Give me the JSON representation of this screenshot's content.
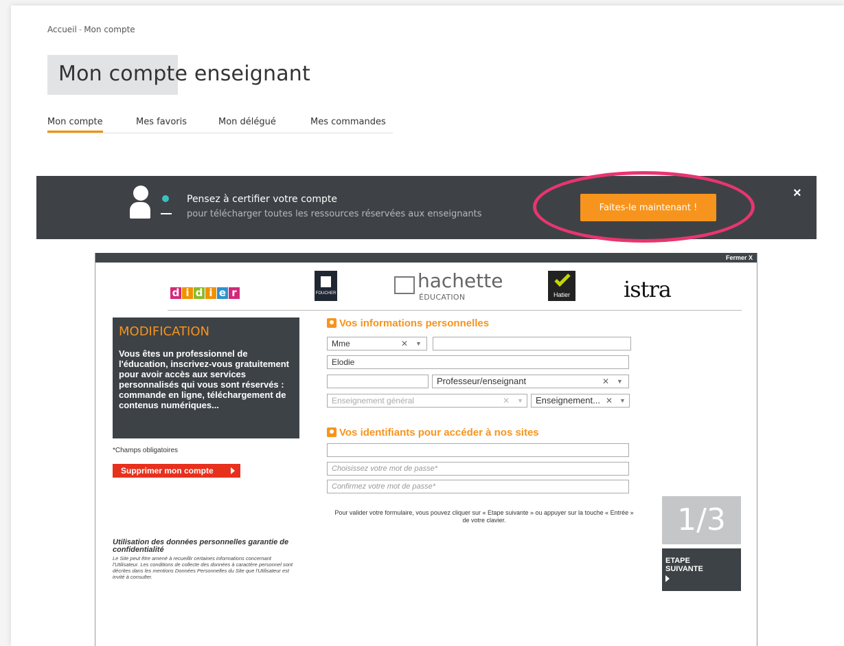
{
  "breadcrumb": {
    "home": "Accueil",
    "separator": "-",
    "current": "Mon compte"
  },
  "page_title": "Mon compte enseignant",
  "tabs": [
    {
      "label": "Mon compte",
      "active": true
    },
    {
      "label": "Mes favoris",
      "active": false
    },
    {
      "label": "Mon délégué",
      "active": false
    },
    {
      "label": "Mes commandes",
      "active": false
    }
  ],
  "banner": {
    "title": "Pensez à certifier votre compte",
    "subtitle": "pour télécharger toutes les ressources réservées aux enseignants",
    "cta_label": "Faites-le maintenant !",
    "close_label": "×",
    "colors": {
      "background": "#3e4246",
      "accent": "#f7941d",
      "dot": "#37c2c0",
      "highlight_ring": "#e8356f"
    }
  },
  "modal": {
    "close_label": "Fermer X",
    "logos": {
      "didier_letters": [
        "d",
        "i",
        "d",
        "i",
        "e",
        "r"
      ],
      "didier_colors": [
        "#d3297a",
        "#f29100",
        "#8dbb25",
        "#f29100",
        "#2b93d1",
        "#d3297a"
      ],
      "foucher": "FOUCHER",
      "hachette_big": "hachette",
      "hachette_small": "ÉDUCATION",
      "hatier": "Hatier",
      "istra": "istra"
    },
    "sidebar": {
      "title": "MODIFICATION",
      "text": "Vous êtes un professionnel de l'éducation, inscrivez-vous gratuitement pour avoir accès aux services personnalisés qui vous sont réservés : commande en ligne, téléchargement de contenus numériques...",
      "required_note": "*Champs obligatoires",
      "delete_label": "Supprimer mon compte"
    },
    "personal": {
      "title": "Vos informations personnelles",
      "civility": "Mme",
      "last_name": "",
      "first_name": "Elodie",
      "field_empty": "",
      "profession": "Professeur/enseignant",
      "teaching_placeholder": "Enseignement général",
      "teaching_value": "Enseignement..."
    },
    "credentials": {
      "title": "Vos identifiants pour accéder à nos sites",
      "email": "",
      "password_placeholder": "Choisissez votre mot de passe*",
      "confirm_placeholder": "Confirmez votre mot de passe*"
    },
    "hint": "Pour valider votre formulaire, vous pouvez cliquer sur « Etape suivante » ou appuyer sur la touche « Entrée » de votre clavier.",
    "step": {
      "progress": "1/3",
      "line1": "ETAPE",
      "line2": "SUIVANTE"
    },
    "privacy": {
      "title": "Utilisation des données personnelles garantie de confidentialité",
      "text": "Le Site peut être amené à recueillir certaines informations concernant l'Utilisateur. Les conditions de collecte des données à caractère personnel sont décrites dans les mentions Données Personnelles du Site que l'Utilisateur est invité à consulter."
    }
  }
}
